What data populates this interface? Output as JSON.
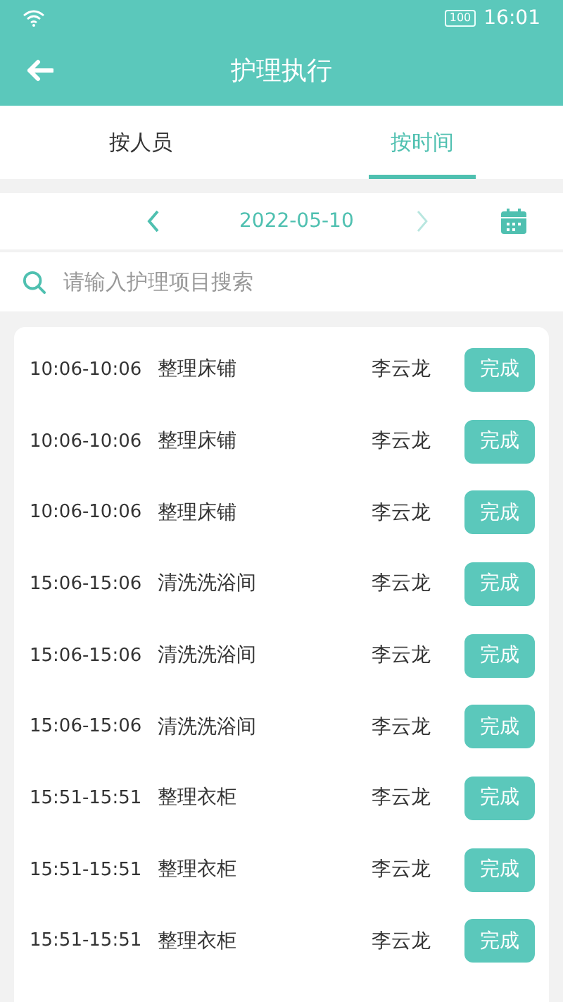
{
  "status_bar": {
    "battery": "100",
    "time": "16:01"
  },
  "header": {
    "title": "护理执行"
  },
  "tabs": [
    {
      "label": "按人员",
      "selected": false
    },
    {
      "label": "按时间",
      "selected": true
    }
  ],
  "date_bar": {
    "date": "2022-05-10",
    "next_disabled": true
  },
  "search": {
    "placeholder": "请输入护理项目搜索"
  },
  "tasks": [
    {
      "time": "10:06-10:06",
      "item": "整理床铺",
      "person": "李云龙",
      "action": "完成"
    },
    {
      "time": "10:06-10:06",
      "item": "整理床铺",
      "person": "李云龙",
      "action": "完成"
    },
    {
      "time": "10:06-10:06",
      "item": "整理床铺",
      "person": "李云龙",
      "action": "完成"
    },
    {
      "time": "15:06-15:06",
      "item": "清洗洗浴间",
      "person": "李云龙",
      "action": "完成"
    },
    {
      "time": "15:06-15:06",
      "item": "清洗洗浴间",
      "person": "李云龙",
      "action": "完成"
    },
    {
      "time": "15:06-15:06",
      "item": "清洗洗浴间",
      "person": "李云龙",
      "action": "完成"
    },
    {
      "time": "15:51-15:51",
      "item": "整理衣柜",
      "person": "李云龙",
      "action": "完成"
    },
    {
      "time": "15:51-15:51",
      "item": "整理衣柜",
      "person": "李云龙",
      "action": "完成"
    },
    {
      "time": "15:51-15:51",
      "item": "整理衣柜",
      "person": "李云龙",
      "action": "完成"
    }
  ]
}
